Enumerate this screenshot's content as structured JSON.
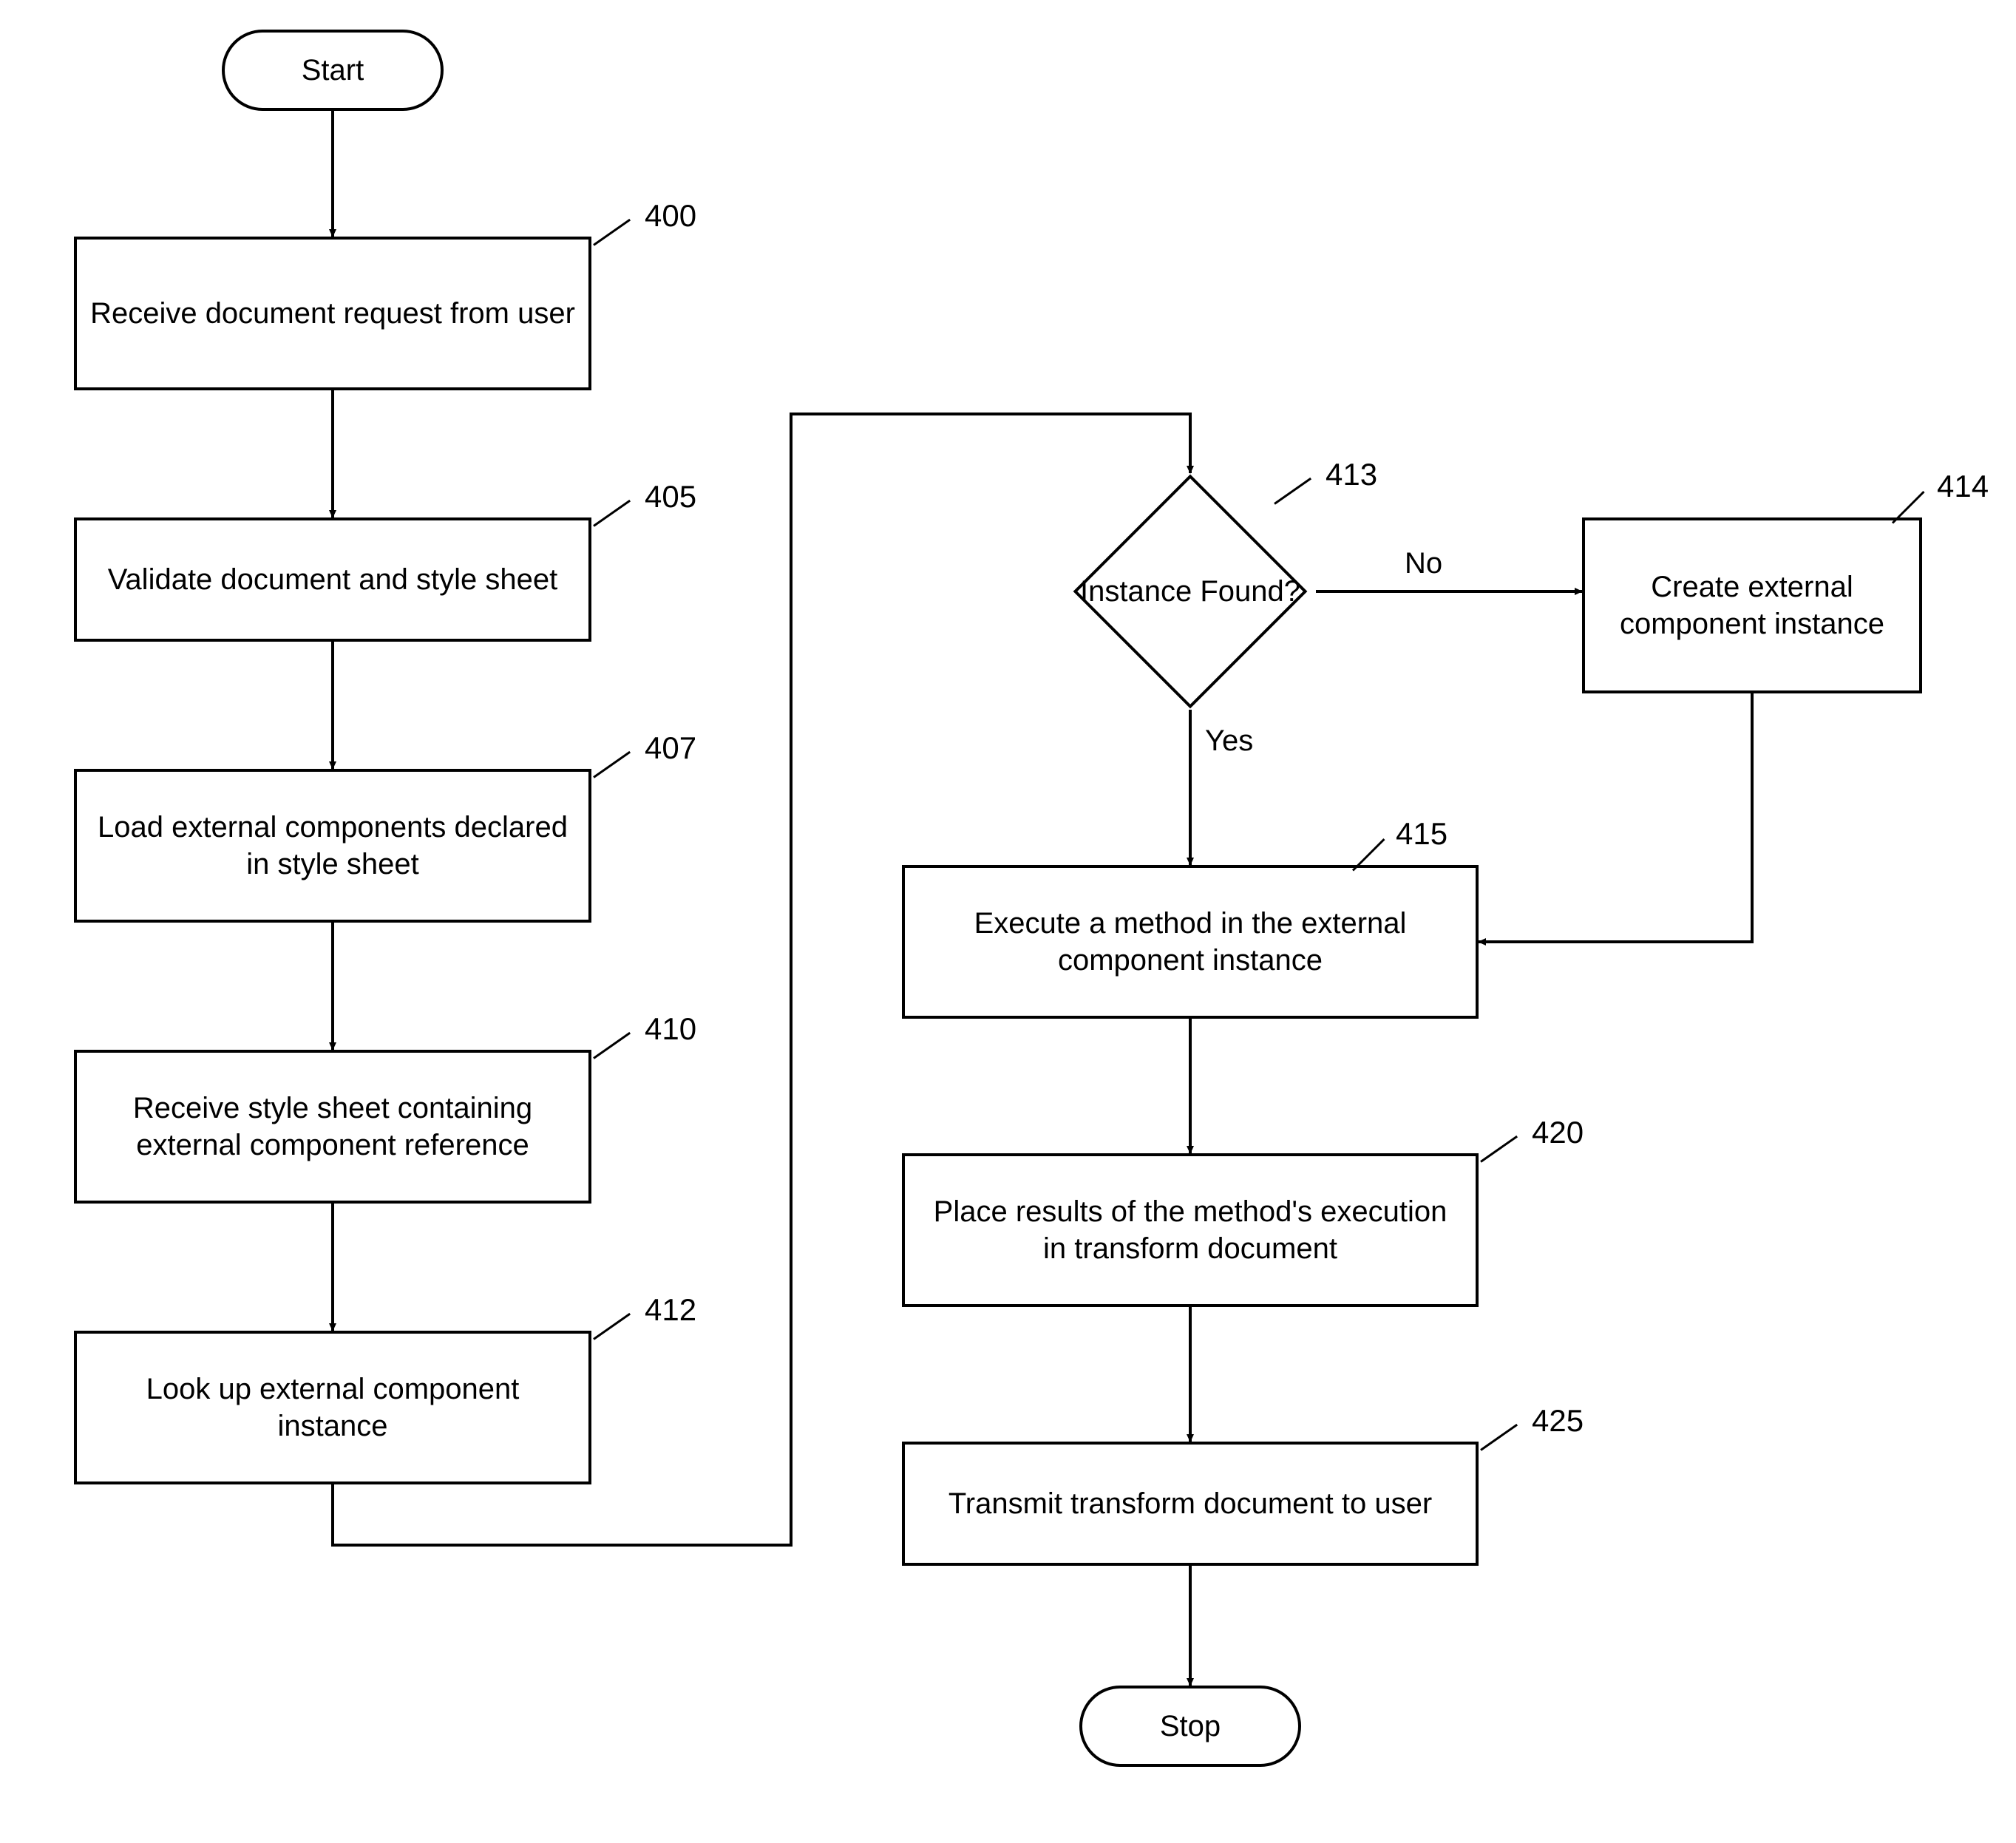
{
  "nodes": {
    "start": {
      "label": "Start"
    },
    "n400": {
      "label": "Receive document request from user",
      "ref": "400"
    },
    "n405": {
      "label": "Validate document and style sheet",
      "ref": "405"
    },
    "n407": {
      "label": "Load external components declared in style sheet",
      "ref": "407"
    },
    "n410": {
      "label": "Receive style sheet containing external component reference",
      "ref": "410"
    },
    "n412": {
      "label": "Look up external component instance",
      "ref": "412"
    },
    "n413": {
      "label": "Instance Found?",
      "ref": "413"
    },
    "n414": {
      "label": "Create external component instance",
      "ref": "414"
    },
    "n415": {
      "label": "Execute a method in the external component instance",
      "ref": "415"
    },
    "n420": {
      "label": "Place results of the method's execution in transform document",
      "ref": "420"
    },
    "n425": {
      "label": "Transmit transform document to user",
      "ref": "425"
    },
    "stop": {
      "label": "Stop"
    }
  },
  "edge_labels": {
    "no": "No",
    "yes": "Yes"
  }
}
